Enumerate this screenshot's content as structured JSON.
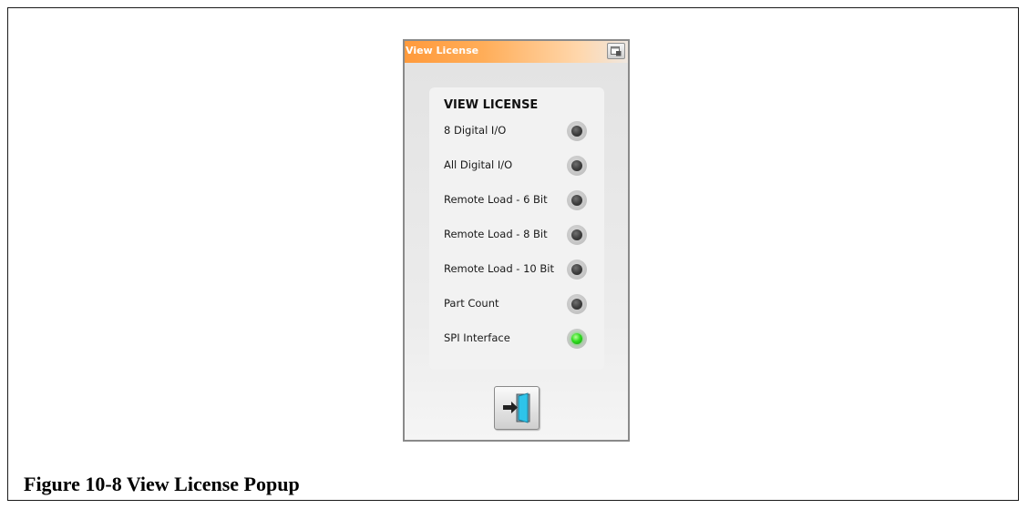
{
  "popup": {
    "title": "View License",
    "window_button_icon": "restore-window-icon",
    "panel_title": "VIEW LICENSE",
    "licenses": [
      {
        "label": "8 Digital I/O",
        "status": "off"
      },
      {
        "label": "All Digital I/O",
        "status": "off"
      },
      {
        "label": "Remote Load - 6 Bit",
        "status": "off"
      },
      {
        "label": "Remote Load - 8 Bit",
        "status": "off"
      },
      {
        "label": "Remote Load - 10 Bit",
        "status": "off"
      },
      {
        "label": "Part Count",
        "status": "off"
      },
      {
        "label": "SPI Interface",
        "status": "on"
      }
    ],
    "exit_button_icon": "exit-door-icon"
  },
  "caption": "Figure 10-8 View License Popup",
  "colors": {
    "titlebar_accent": "#ff9a3c",
    "led_off": "#3c3c3c",
    "led_on": "#2fdd1f",
    "exit_door": "#2ec4ea"
  }
}
